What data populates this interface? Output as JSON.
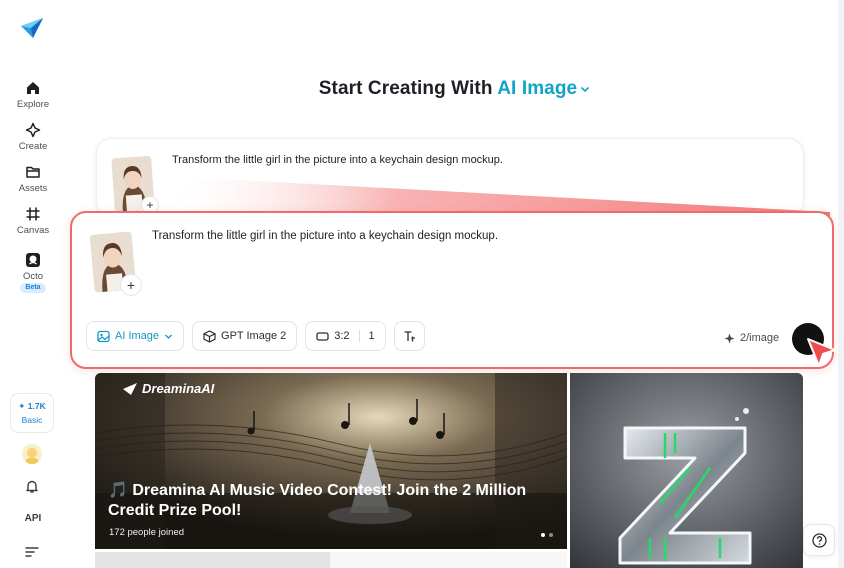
{
  "sidebar": {
    "items": [
      {
        "label": "Explore",
        "icon": "home-icon"
      },
      {
        "label": "Create",
        "icon": "create-sparkle-icon"
      },
      {
        "label": "Assets",
        "icon": "folder-icon"
      },
      {
        "label": "Canvas",
        "icon": "canvas-grid-icon"
      },
      {
        "label": "Octo",
        "icon": "octo-icon",
        "badge": "Beta"
      }
    ],
    "credits": {
      "count": "1.7K",
      "plan": "Basic"
    },
    "api_label": "API"
  },
  "headline": {
    "prefix": "Start Creating With",
    "mode": "AI Image"
  },
  "previous_prompt": {
    "text": "Transform the little girl in the picture into a keychain design mockup."
  },
  "prompt": {
    "text": "Transform the little girl in the picture into a keychain design mockup.",
    "add_label": "+",
    "toolbar": {
      "mode_label": "AI Image",
      "model_label": "GPT Image 2",
      "ratio_label": "3:2",
      "count_label": "1"
    },
    "cost_label": "2/image"
  },
  "banner": {
    "brand": "DreaminaAI",
    "title": "🎵 Dreamina AI Music Video Contest! Join the 2 Million Credit Prize Pool!",
    "joined": "172  people joined"
  },
  "colors": {
    "accent": "#11a3c8",
    "highlight_border": "#ef6b6b",
    "send": "#111111"
  }
}
